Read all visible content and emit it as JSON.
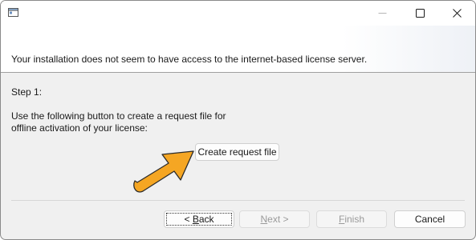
{
  "window": {
    "icon": "app-window-icon",
    "caption_buttons": [
      "minimize-icon",
      "maximize-icon",
      "close-icon"
    ]
  },
  "header": {
    "text": "Your installation does not seem to have access to the internet-based license server."
  },
  "body": {
    "step_label": "Step 1:",
    "instruction_line1": "Use the following button to create a request file for",
    "instruction_line2": "offline activation of your license:",
    "create_button": "Create request file",
    "pointer": "orange-arrow-icon"
  },
  "footer": {
    "back_mnemonic": "B",
    "back_prefix": "< ",
    "back_rest": "ack",
    "next_mnemonic": "N",
    "next_rest": "ext >",
    "finish_mnemonic": "F",
    "finish_rest": "inish",
    "cancel": "Cancel"
  },
  "colors": {
    "arrow_fill": "#f5a623",
    "arrow_stroke": "#2b2b2b",
    "disabled_text": "#9a9a9a"
  }
}
